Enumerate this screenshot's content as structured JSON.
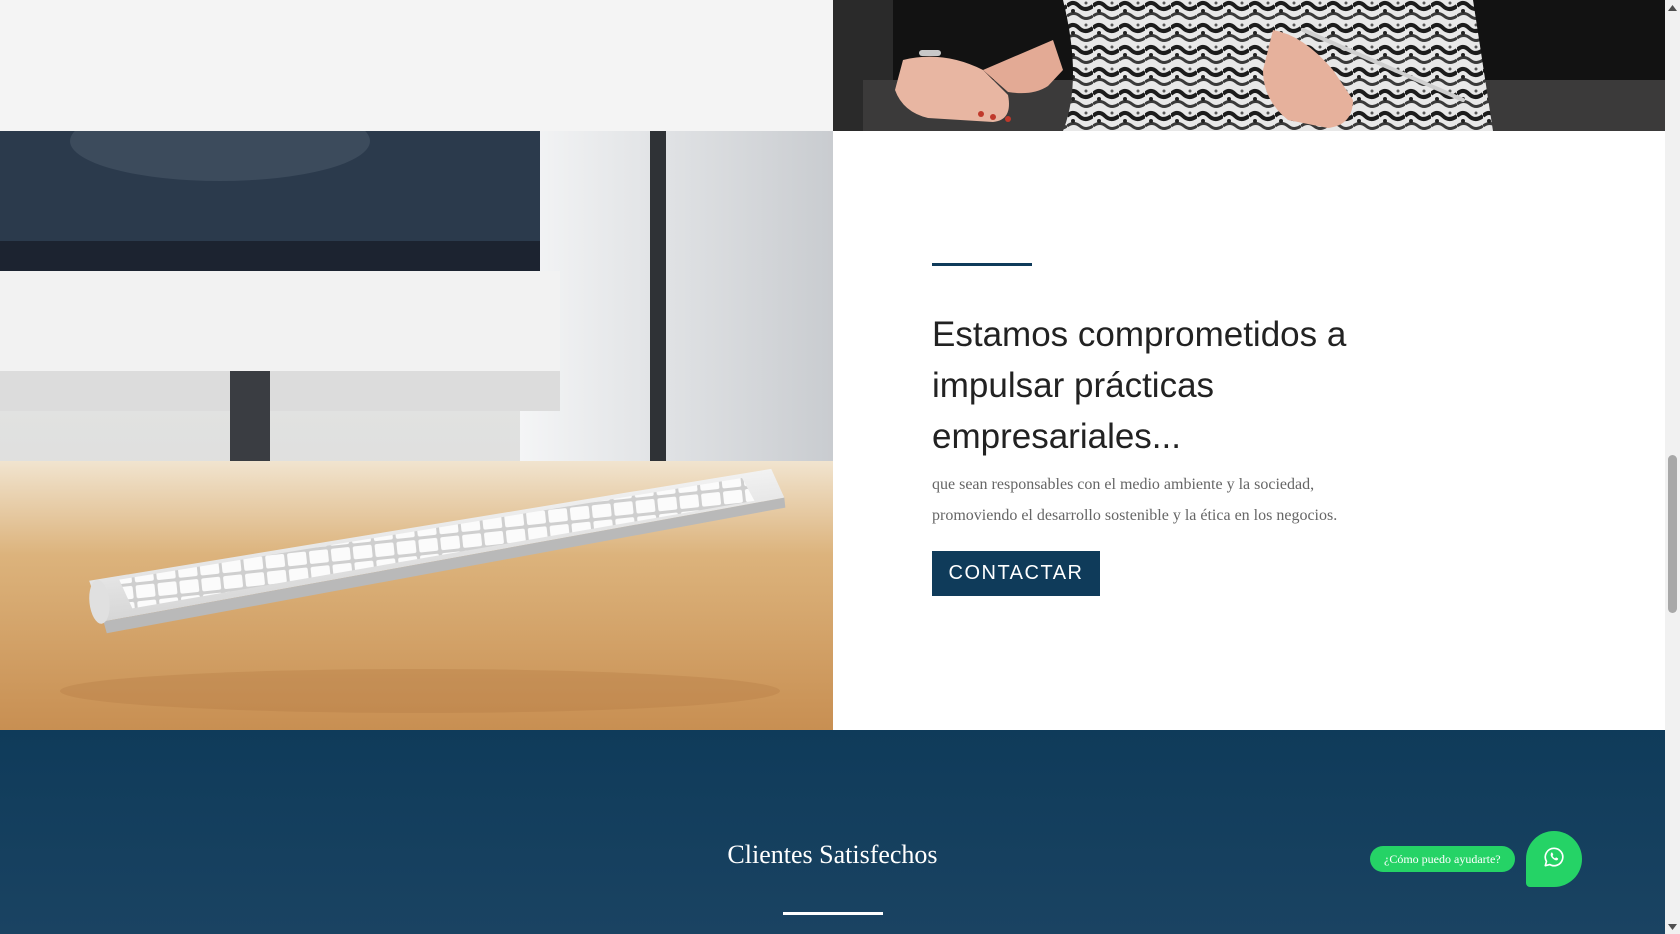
{
  "feature": {
    "headline": "Estamos comprometidos a impulsar prácticas empresariales...",
    "body_line_1": "que sean responsables con el medio ambiente y la sociedad,",
    "body_line_2": "promoviendo el desarrollo sostenible y la ética en los negocios.",
    "cta_label": "CONTACTAR"
  },
  "clients": {
    "title": "Clientes Satisfechos"
  },
  "whatsapp": {
    "prompt": "¿Cómo puedo ayudarte?",
    "icon": "whatsapp-icon"
  },
  "images": {
    "top_right": "woman-signing-document-photo",
    "left": "keyboard-on-desk-photo"
  },
  "colors": {
    "brand": "#0f3b5a",
    "whatsapp": "#25d366"
  }
}
